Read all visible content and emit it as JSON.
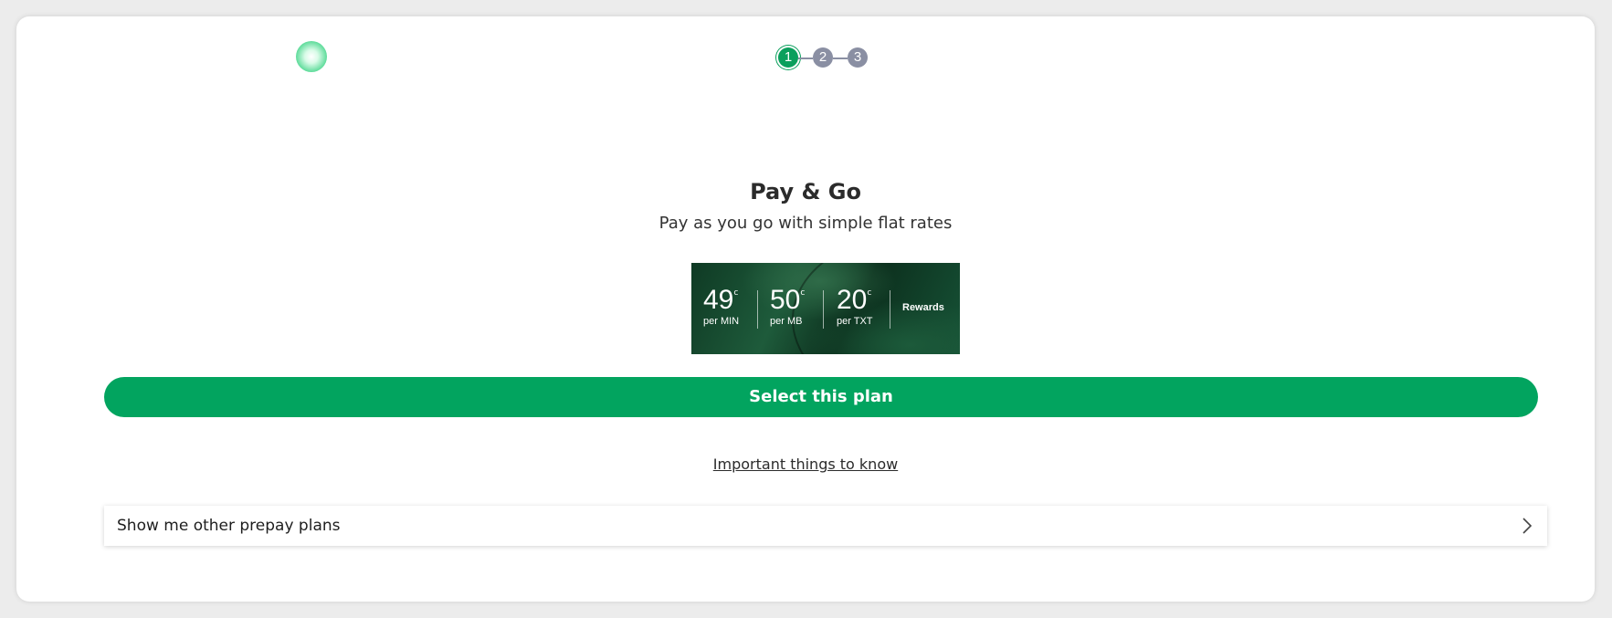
{
  "stepper": {
    "steps": [
      "1",
      "2",
      "3"
    ],
    "active_index": 0
  },
  "plan": {
    "title": "Pay & Go",
    "subtitle": "Pay as you go with simple flat rates"
  },
  "banner": {
    "rates": [
      {
        "value": "49",
        "unit": "c",
        "label": "per MIN"
      },
      {
        "value": "50",
        "unit": "c",
        "label": "per MB"
      },
      {
        "value": "20",
        "unit": "c",
        "label": "per TXT"
      }
    ],
    "rewards_label": "Rewards"
  },
  "actions": {
    "select_label": "Select this plan",
    "important_link": "Important things to know",
    "other_plans_label": "Show me other prepay plans"
  },
  "colors": {
    "accent": "#02a45f",
    "step_inactive": "#8a8fa3"
  }
}
